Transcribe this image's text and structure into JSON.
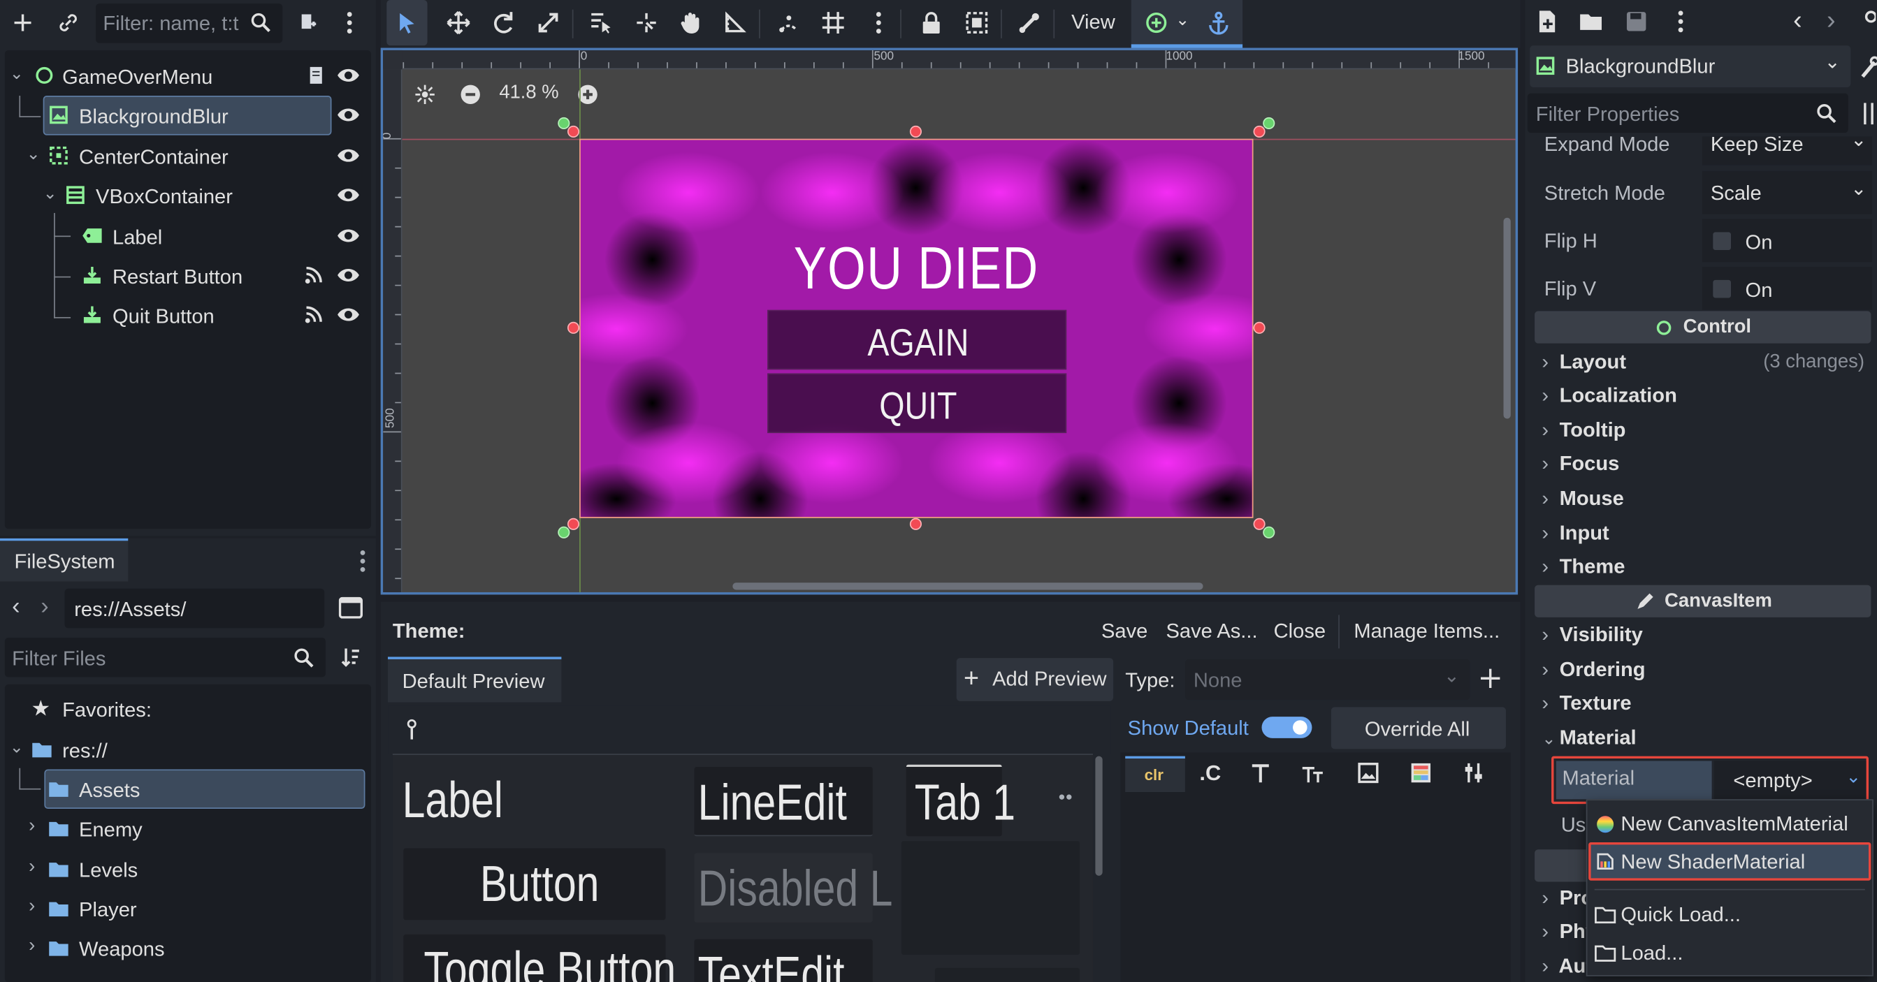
{
  "scene": {
    "search_placeholder": "Filter: name, t:t",
    "nodes": [
      {
        "label": "GameOverMenu"
      },
      {
        "label": "BlackgroundBlur"
      },
      {
        "label": "CenterContainer"
      },
      {
        "label": "VBoxContainer"
      },
      {
        "label": "Label"
      },
      {
        "label": "Restart Button"
      },
      {
        "label": "Quit Button"
      }
    ]
  },
  "filesystem": {
    "tab": "FileSystem",
    "path": "res://Assets/",
    "filter_placeholder": "Filter Files",
    "items": [
      {
        "label": "Favorites:"
      },
      {
        "label": "res://"
      },
      {
        "label": "Assets"
      },
      {
        "label": "Enemy"
      },
      {
        "label": "Levels"
      },
      {
        "label": "Player"
      },
      {
        "label": "Weapons"
      }
    ]
  },
  "toolbar": {
    "view_label": "View"
  },
  "viewport": {
    "zoom": "41.8 %",
    "ruler_top": [
      "0",
      "500",
      "1000",
      "1500"
    ],
    "ruler_left": [
      "0",
      "500"
    ],
    "game": {
      "title": "YOU DIED",
      "buttons": [
        "AGAIN",
        "QUIT"
      ]
    }
  },
  "theme_editor": {
    "title": "Theme:",
    "actions": [
      "Save",
      "Save As...",
      "Close",
      "Manage Items..."
    ],
    "preview_tab": "Default Preview",
    "add_preview": "Add Preview",
    "type_label": "Type:",
    "type_value": "None",
    "show_default": "Show Default",
    "override_all": "Override All",
    "icon_tab_first": "clr",
    "icon_tab_second": ".C",
    "widgets": {
      "label": "Label",
      "button": "Button",
      "toggle": "Toggle Button",
      "lineedit": "LineEdit",
      "disabled": "Disabled L",
      "textedit": "TextEdit",
      "tab": "Tab 1"
    }
  },
  "inspector": {
    "node_name": "BlackgroundBlur",
    "filter_placeholder": "Filter Properties",
    "expand_mode": {
      "label": "Expand Mode",
      "value": "Keep Size"
    },
    "stretch_mode": {
      "label": "Stretch Mode",
      "value": "Scale"
    },
    "flip_h": {
      "label": "Flip H",
      "value": "On"
    },
    "flip_v": {
      "label": "Flip V",
      "value": "On"
    },
    "sections": {
      "control": "Control",
      "canvasitem": "CanvasItem"
    },
    "layout_changes": "(3 changes)",
    "control_cats": [
      "Layout",
      "Localization",
      "Tooltip",
      "Focus",
      "Mouse",
      "Input",
      "Theme"
    ],
    "canvas_cats": [
      "Visibility",
      "Ordering",
      "Texture",
      "Material"
    ],
    "material": {
      "label": "Material",
      "value": "<empty>"
    },
    "hidden_rows": [
      "Us",
      "Pro",
      "Phy",
      "Aut"
    ]
  },
  "dropdown": {
    "items": [
      "New CanvasItemMaterial",
      "New ShaderMaterial",
      "Quick Load...",
      "Load..."
    ]
  },
  "colors": {
    "accent": "#5c9ce6",
    "node_green": "#8eef97",
    "highlight_red": "#e6463c",
    "game_magenta": "#e829f0"
  }
}
